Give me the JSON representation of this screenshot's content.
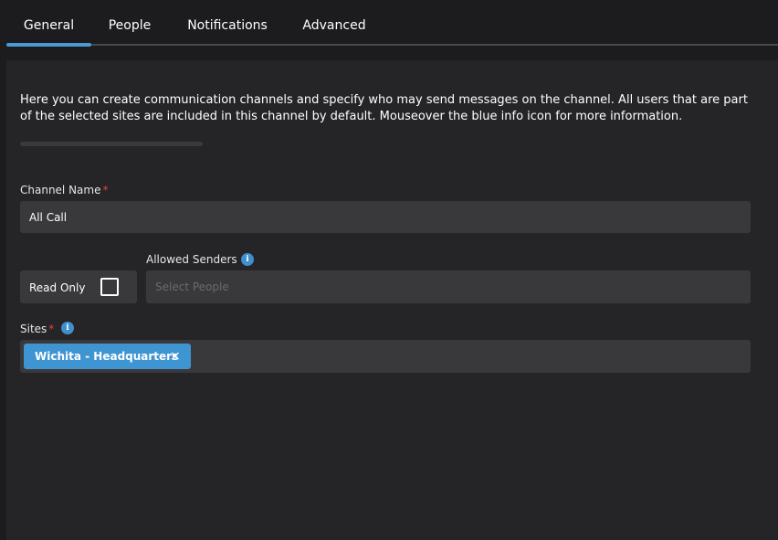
{
  "tabs": [
    {
      "label": "General",
      "active": true
    },
    {
      "label": "People",
      "active": false
    },
    {
      "label": "Notifications",
      "active": false
    },
    {
      "label": "Advanced",
      "active": false
    }
  ],
  "intro_text": "Here you can create communication channels and specify who may send messages on the channel. All users that are part of the selected sites are included in this channel by default. Mouseover the blue info icon for more information.",
  "channel_name": {
    "label": "Channel Name",
    "required_mark": "*",
    "value": "All Call"
  },
  "read_only": {
    "label": "Read Only",
    "checked": false
  },
  "allowed_senders": {
    "label": "Allowed Senders",
    "placeholder": "Select People",
    "info_icon": "info-icon"
  },
  "sites": {
    "label": "Sites",
    "required_mark": "*",
    "info_icon": "info-icon",
    "selected": [
      {
        "label": "Wichita - Headquarters",
        "remove_glyph": "×"
      }
    ]
  },
  "colors": {
    "accent": "#4a9ad6",
    "chip": "#3f95d1",
    "required": "#e0433b",
    "background": "#1c1c1e",
    "panel": "#252527",
    "field": "#39393b"
  }
}
